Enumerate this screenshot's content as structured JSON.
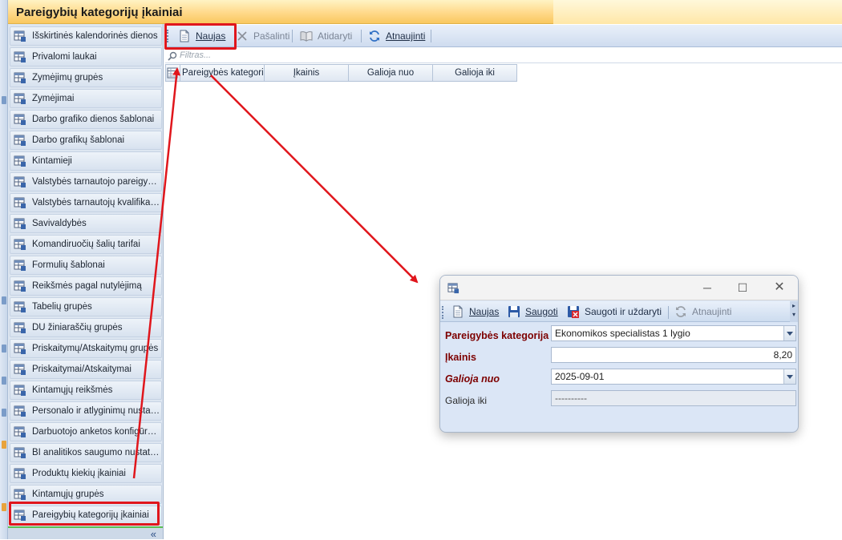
{
  "window": {
    "title": "Pareigybių kategorijų įkainiai"
  },
  "sidebar": {
    "items": [
      {
        "label": "Išskirtinės kalendorinės dienos",
        "name": "sidebar-item-isskirtines-dienos"
      },
      {
        "label": "Privalomi laukai",
        "name": "sidebar-item-privalomi-laukai"
      },
      {
        "label": "Žymėjimų grupės",
        "name": "sidebar-item-zymejimu-grupes"
      },
      {
        "label": "Žymėjimai",
        "name": "sidebar-item-zymejimai"
      },
      {
        "label": "Darbo grafiko dienos šablonai",
        "name": "sidebar-item-darbo-grafiko-dienos-sablonai"
      },
      {
        "label": "Darbo grafikų šablonai",
        "name": "sidebar-item-darbo-grafiku-sablonai"
      },
      {
        "label": "Kintamieji",
        "name": "sidebar-item-kintamieji"
      },
      {
        "label": "Valstybės tarnautojo pareigybė…",
        "name": "sidebar-item-valstybes-tarnautojo-pareigybe"
      },
      {
        "label": "Valstybės tarnautojų kvalifikaci…",
        "name": "sidebar-item-valstybes-tarnautoju-kvalifikacija"
      },
      {
        "label": "Savivaldybės",
        "name": "sidebar-item-savivaldybes"
      },
      {
        "label": "Komandiruočių šalių tarifai",
        "name": "sidebar-item-komandiruociu-saliu-tarifai"
      },
      {
        "label": "Formulių šablonai",
        "name": "sidebar-item-formuliu-sablonai"
      },
      {
        "label": "Reikšmės pagal nutylėjimą",
        "name": "sidebar-item-reiksmes-pagal-nutylejima"
      },
      {
        "label": "Tabelių grupės",
        "name": "sidebar-item-tabeliu-grupes"
      },
      {
        "label": "DU žiniaraščių grupės",
        "name": "sidebar-item-du-ziniarasciu-grupes"
      },
      {
        "label": "Priskaitymų/Atskaitymų grupės",
        "name": "sidebar-item-priskaitymu-atskaitymu-grupes"
      },
      {
        "label": "Priskaitymai/Atskaitymai",
        "name": "sidebar-item-priskaitymai-atskaitymai"
      },
      {
        "label": "Kintamųjų reikšmės",
        "name": "sidebar-item-kintamuju-reiksmes"
      },
      {
        "label": "Personalo ir atlyginimų nustaty…",
        "name": "sidebar-item-personalo-nustatymai"
      },
      {
        "label": "Darbuotojo anketos konfigūra…",
        "name": "sidebar-item-darbuotojo-anketos-konfiguracija"
      },
      {
        "label": "BI analitikos saugumo nustaty…",
        "name": "sidebar-item-bi-analitikos-nustatymai"
      },
      {
        "label": "Produktų kiekių įkainiai",
        "name": "sidebar-item-produktu-kiekiu-ikainiai"
      },
      {
        "label": "Kintamųjų grupės",
        "name": "sidebar-item-kintamuju-grupes"
      },
      {
        "label": "Pareigybių kategorijų įkainiai",
        "name": "sidebar-item-pareigybiu-kategoriju-ikainiai"
      }
    ],
    "collapse_glyph": "«"
  },
  "toolbar": {
    "new_label": "Naujas",
    "delete_label": "Pašalinti",
    "open_label": "Atidaryti",
    "refresh_label": "Atnaujinti"
  },
  "filter": {
    "placeholder": "Filtras..."
  },
  "grid": {
    "columns": [
      "Pareigybės kategori",
      "Įkainis",
      "Galioja nuo",
      "Galioja iki"
    ]
  },
  "dialog": {
    "toolbar": {
      "new_label": "Naujas",
      "save_label": "Saugoti",
      "save_close_label": "Saugoti ir uždaryti",
      "refresh_label": "Atnaujinti"
    },
    "fields": {
      "category": {
        "label": "Pareigybės kategorija",
        "value": "Ekonomikos specialistas 1 lygio"
      },
      "rate": {
        "label": "Įkainis",
        "value": "8,20"
      },
      "valid_from": {
        "label": "Galioja nuo",
        "value": "2025-09-01"
      },
      "valid_to": {
        "label": "Galioja iki",
        "value": "----‑--‑--"
      }
    }
  },
  "colors": {
    "accent_red": "#e0161c",
    "title_gradient": "#ffd98a",
    "required_label": "#7d0000"
  }
}
